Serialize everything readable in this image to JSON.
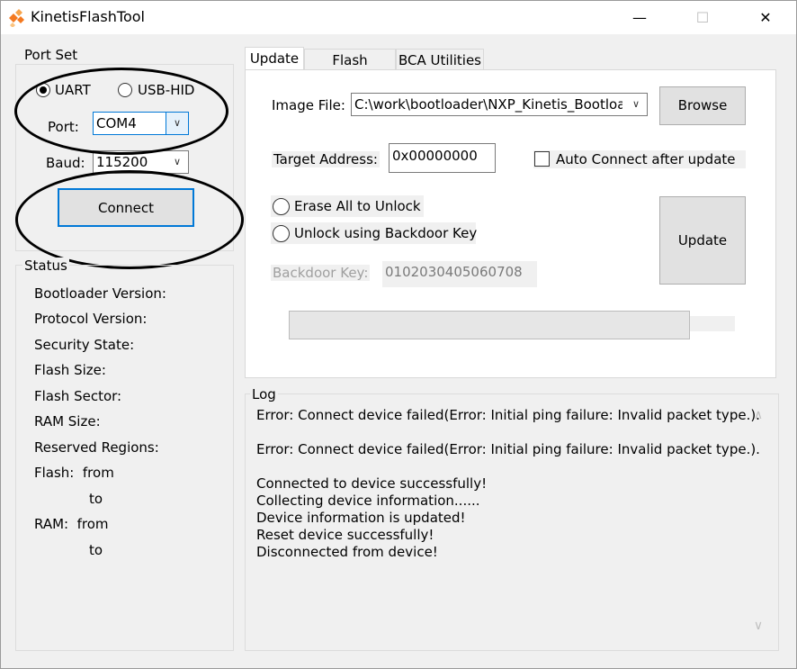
{
  "window": {
    "title": "KinetisFlashTool",
    "minimize": "—",
    "maximize": "☐",
    "close": "✕"
  },
  "port_set": {
    "label": "Port Set",
    "radio_uart": "UART",
    "radio_usbhid": "USB-HID",
    "port_label": "Port:",
    "port_value": "COM4",
    "baud_label": "Baud:",
    "baud_value": "115200",
    "connect_button": "Connect"
  },
  "status": {
    "label": "Status",
    "bootloader_version": "Bootloader Version:",
    "protocol_version": "Protocol Version:",
    "security_state": "Security State:",
    "flash_size": "Flash Size:",
    "flash_sector": "Flash Sector:",
    "ram_size": "RAM Size:",
    "reserved_regions": "Reserved Regions:",
    "flash_from": "Flash:  from",
    "flash_to": "to",
    "ram_from": "RAM:  from",
    "ram_to": "to"
  },
  "tabs": [
    "Update",
    "Flash Utilities",
    "BCA Utilities"
  ],
  "update": {
    "image_file_label": "Image File:",
    "image_file_value": "C:\\work\\bootloader\\NXP_Kinetis_Bootloader",
    "browse_button": "Browse",
    "target_address_label": "Target Address:",
    "target_address_value": "0x00000000",
    "auto_connect_label": "Auto Connect after update",
    "erase_all_label": "Erase All to Unlock",
    "unlock_backdoor_label": "Unlock using Backdoor Key",
    "backdoor_key_label": "Backdoor Key:",
    "backdoor_key_value": "0102030405060708",
    "update_button": "Update",
    "progress": 0
  },
  "log": {
    "label": "Log",
    "lines": [
      "Error: Connect device failed(Error: Initial ping failure: Invalid packet type.).",
      "Error: Connect device failed(Error: Initial ping failure: Invalid packet type.).",
      "Connected to device successfully!",
      "Collecting device information......",
      "Device information is updated!",
      "Reset device successfully!",
      "Disconnected from device!"
    ]
  }
}
